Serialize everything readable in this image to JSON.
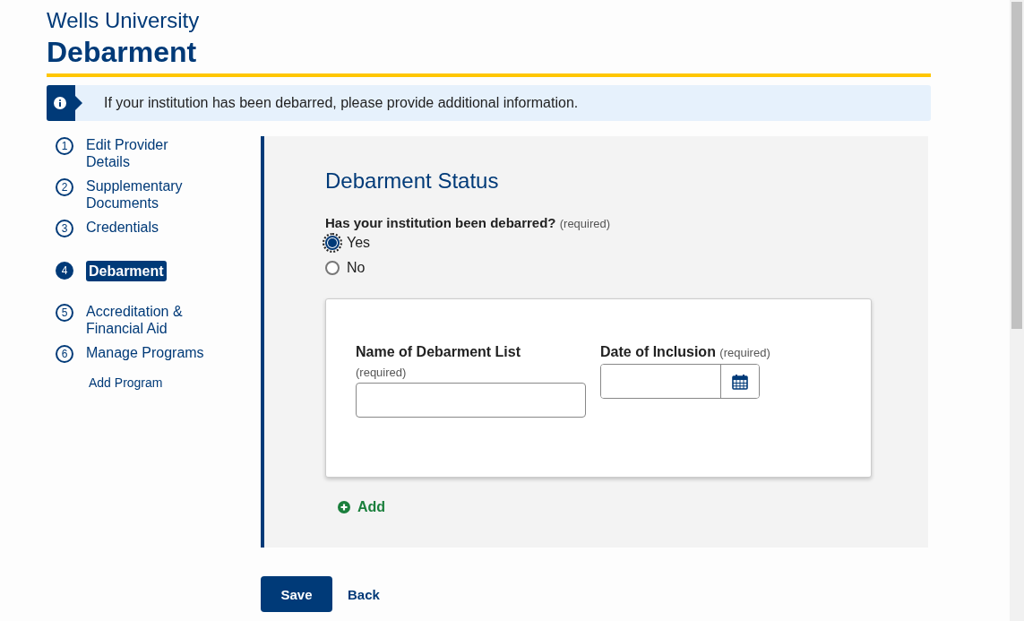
{
  "header": {
    "institution": "Wells University",
    "title": "Debarment"
  },
  "info_banner": {
    "text": "If your institution has been debarred, please provide additional information."
  },
  "steps": [
    {
      "number": "1",
      "label": "Edit Provider Details",
      "selected": false
    },
    {
      "number": "2",
      "label": "Supplementary Documents",
      "selected": false
    },
    {
      "number": "3",
      "label": "Credentials",
      "selected": false
    },
    {
      "number": "4",
      "label": "Debarment",
      "selected": true
    },
    {
      "number": "5",
      "label": "Accreditation & Financial Aid",
      "selected": false
    },
    {
      "number": "6",
      "label": "Manage Programs",
      "selected": false,
      "children": [
        {
          "label": "Add Program"
        }
      ]
    }
  ],
  "section": {
    "title": "Debarment Status",
    "question": {
      "label": "Has your institution been debarred?",
      "hint": "(required)",
      "options": [
        {
          "label": "Yes",
          "selected": true
        },
        {
          "label": "No",
          "selected": false
        }
      ]
    },
    "fields": [
      {
        "kind": "text",
        "label": "Name of Debarment List",
        "hint": "(required)"
      },
      {
        "kind": "date",
        "label": "Date of Inclusion",
        "hint": "(required)"
      }
    ],
    "add_label": "Add"
  },
  "buttons": {
    "save": "Save",
    "back": "Back"
  }
}
